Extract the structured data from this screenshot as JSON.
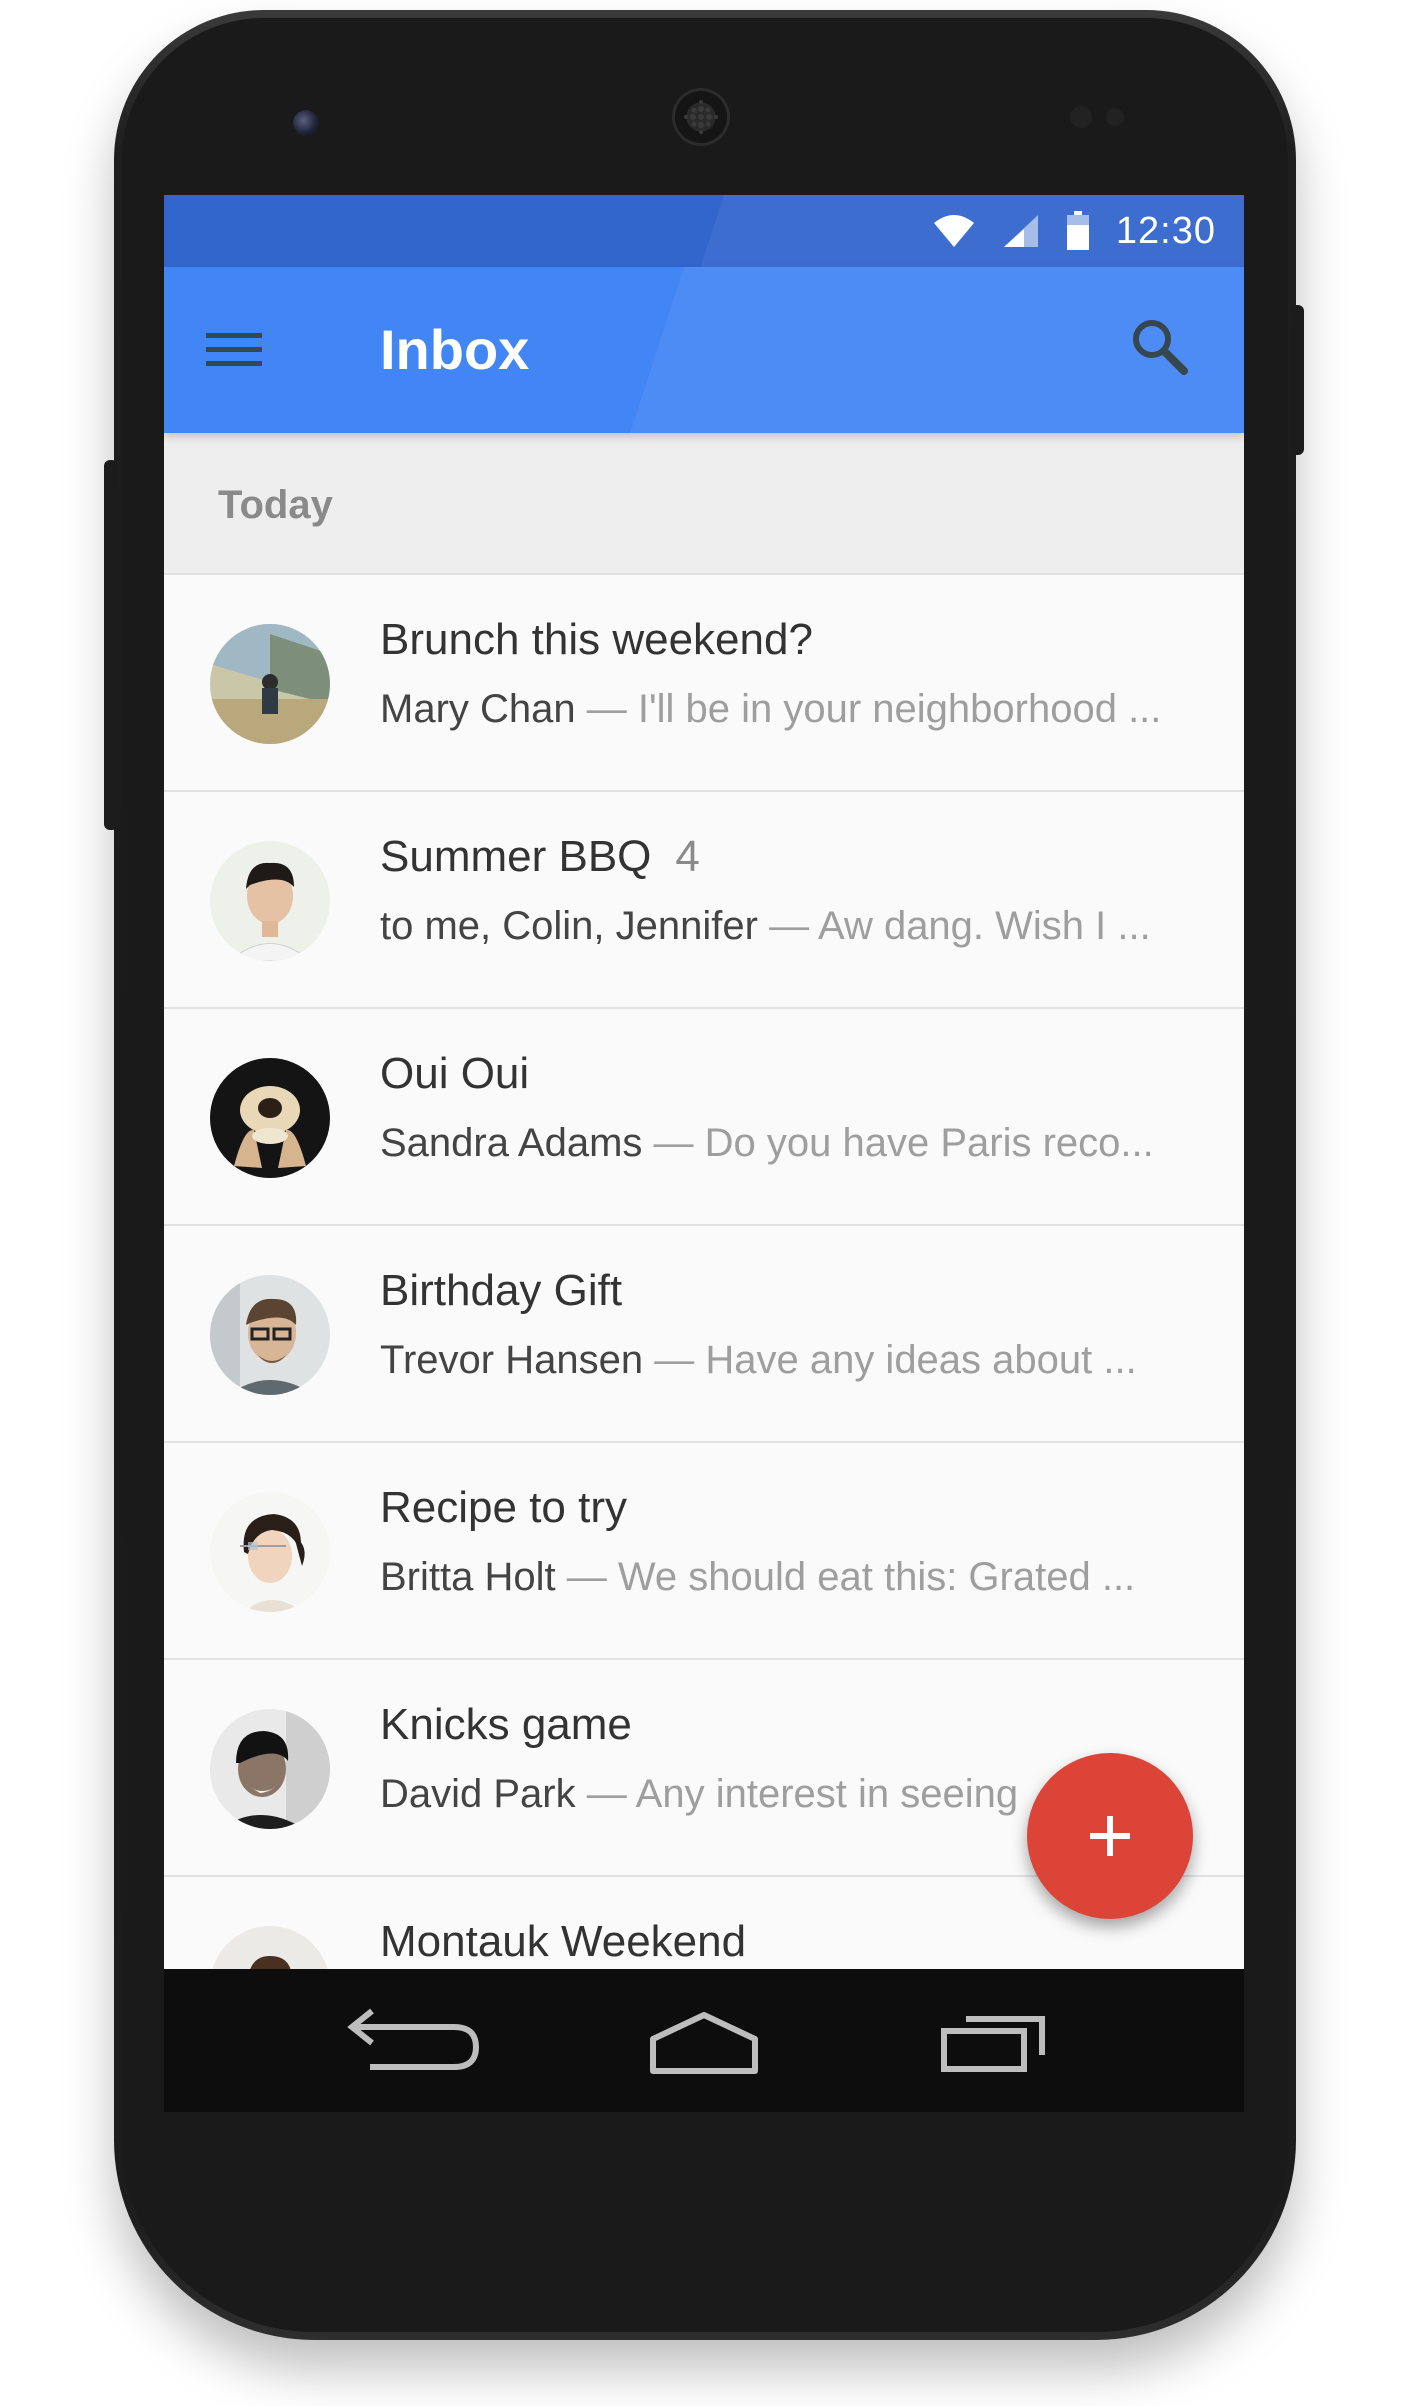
{
  "status_bar": {
    "time": "12:30",
    "icons": [
      "wifi-icon",
      "signal-icon",
      "battery-icon"
    ]
  },
  "app_bar": {
    "title": "Inbox",
    "menu_icon": "hamburger-menu-icon",
    "search_icon": "search-icon"
  },
  "section": {
    "label": "Today"
  },
  "threads": [
    {
      "subject": "Brunch this weekend?",
      "count": "",
      "sender": "Mary Chan",
      "separator": "—",
      "snippet": "I'll be in your neighborhood ..."
    },
    {
      "subject": "Summer BBQ",
      "count": "4",
      "sender": "to me, Colin, Jennifer",
      "separator": "—",
      "snippet": "Aw dang. Wish I ..."
    },
    {
      "subject": "Oui Oui",
      "count": "",
      "sender": "Sandra Adams",
      "separator": "—",
      "snippet": "Do you have Paris reco..."
    },
    {
      "subject": "Birthday Gift",
      "count": "",
      "sender": "Trevor Hansen",
      "separator": "—",
      "snippet": "Have any ideas about ..."
    },
    {
      "subject": "Recipe to try",
      "count": "",
      "sender": "Britta Holt",
      "separator": "—",
      "snippet": "We should eat this: Grated ..."
    },
    {
      "subject": "Knicks game",
      "count": "",
      "sender": "David Park",
      "separator": "—",
      "snippet": "Any interest in seeing"
    },
    {
      "subject": "Montauk Weekend",
      "count": "",
      "sender": "",
      "separator": "",
      "snippet": ""
    }
  ],
  "fab": {
    "icon": "plus-icon",
    "color": "#db4437"
  },
  "nav_bar": {
    "icons": [
      "back-icon",
      "home-icon",
      "recents-icon"
    ]
  },
  "colors": {
    "status_bar": "#3366cc",
    "app_bar": "#4285f4",
    "fab": "#db4437",
    "list_background": "#fafafa",
    "section_background": "#eeeeee"
  }
}
